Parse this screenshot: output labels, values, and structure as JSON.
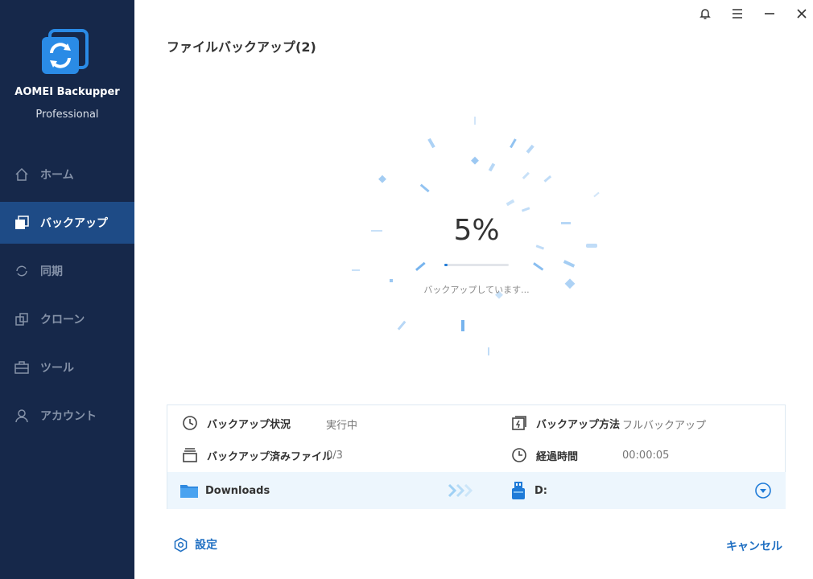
{
  "app": {
    "name": "AOMEI Backupper",
    "edition": "Professional"
  },
  "sidebar": {
    "items": [
      {
        "label": "ホーム",
        "icon": "home-icon",
        "active": false
      },
      {
        "label": "バックアップ",
        "icon": "backup-icon",
        "active": true
      },
      {
        "label": "同期",
        "icon": "sync-icon",
        "active": false
      },
      {
        "label": "クローン",
        "icon": "clone-icon",
        "active": false
      },
      {
        "label": "ツール",
        "icon": "toolbox-icon",
        "active": false
      },
      {
        "label": "アカウント",
        "icon": "user-icon",
        "active": false
      }
    ]
  },
  "window": {
    "controls": [
      "bell-icon",
      "menu-icon",
      "minimize-icon",
      "close-icon"
    ]
  },
  "page": {
    "title": "ファイルバックアップ(2)"
  },
  "progress": {
    "percent_text": "5%",
    "value": 0.05,
    "status": "バックアップしています..."
  },
  "info": {
    "status_label": "バックアップ状況",
    "status_value": "実行中",
    "method_label": "バックアップ方法",
    "method_value": "フルバックアップ",
    "files_label": "バックアップ済みファイル",
    "files_value": "0/3",
    "elapsed_label": "経過時間",
    "elapsed_value": "00:00:05"
  },
  "source": {
    "label": "Downloads",
    "icon": "folder-icon"
  },
  "destination": {
    "label": "D:",
    "icon": "usb-drive-icon"
  },
  "footer": {
    "settings_label": "設定",
    "cancel_label": "キャンセル"
  },
  "colors": {
    "sidebar_bg": "#16284a",
    "active_bg": "#1e4b86",
    "accent": "#1f7bd8",
    "path_bar_bg": "#edf6fd"
  }
}
